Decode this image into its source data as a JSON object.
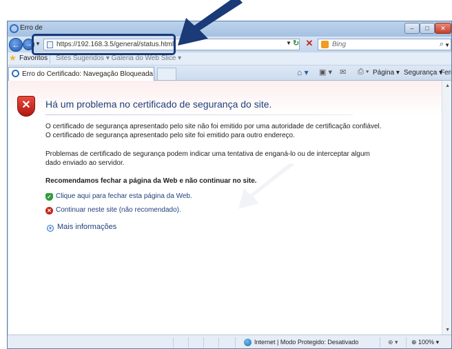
{
  "window": {
    "title": "Erro de"
  },
  "nav": {
    "url": "https://192.168.3.5/general/status.html"
  },
  "search": {
    "placeholder": "Bing"
  },
  "favorites": {
    "label": "Favoritos",
    "suggested": "Sites Sugeridos ▾  Galeria do Web Slice ▾"
  },
  "tabs": [
    {
      "label": "Erro do Certificado: Navegação Bloqueada"
    }
  ],
  "commands": {
    "pagina": "Página ▾",
    "seguranca": "Segurança ▾",
    "ferramentas": "Ferramentas ▾"
  },
  "cert": {
    "title": "Há um problema no certificado de segurança do site.",
    "para1_line1": "O certificado de segurança apresentado pelo site não foi emitido por uma autoridade de certificação confiável.",
    "para1_line2": "O certificado de segurança apresentado pelo site foi emitido para outro endereço.",
    "para2_line1": "Problemas de certificado de segurança podem indicar uma tentativa de enganá-lo ou de interceptar algum",
    "para2_line2": "dado enviado ao servidor.",
    "recommend": "Recomendamos fechar a página da Web e não continuar no site.",
    "close_link": "Clique aqui para fechar esta página da Web.",
    "continue_link": "Continuar neste site (não recomendado).",
    "more_info": "Mais informações"
  },
  "status": {
    "zone": "Internet | Modo Protegido: Desativado",
    "zoom": "100%"
  },
  "colors": {
    "callout": "#1a3a78",
    "link": "#1f3f7a",
    "danger": "#c8231b"
  }
}
